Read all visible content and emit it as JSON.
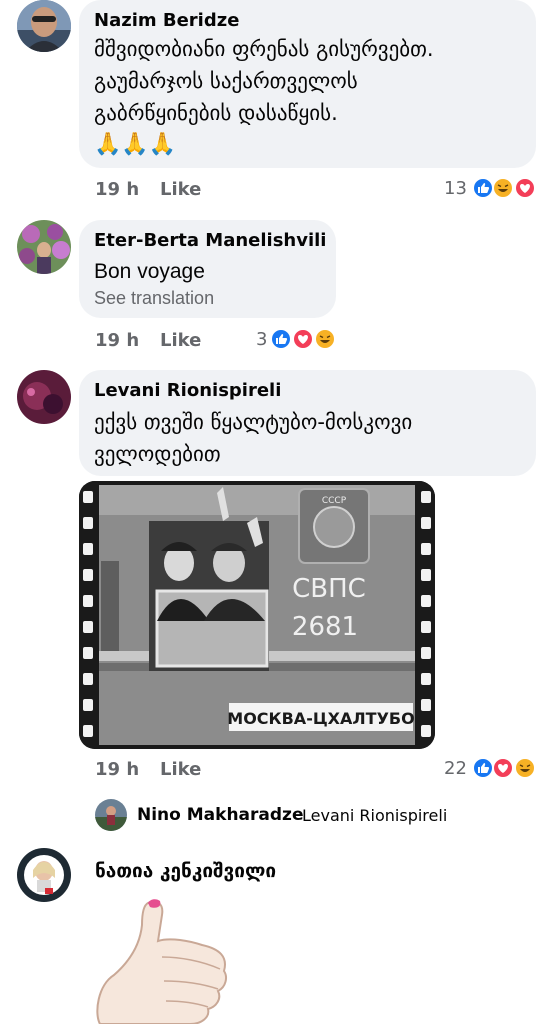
{
  "comments": [
    {
      "author": "Nazim Beridze",
      "lines": [
        "მშვიდობიანი ფრენას გისურვებთ.",
        "გაუმარჯოს საქართველოს",
        "გაბრწყინების დასაწყის."
      ],
      "emoji": "🙏🙏🙏",
      "time": "19 h",
      "like": "Like",
      "reaction_count": "13"
    },
    {
      "author": "Eter-Berta Manelishvili",
      "text": "Bon voyage",
      "see_translation": "See translation",
      "time": "19 h",
      "like": "Like",
      "reaction_count": "3"
    },
    {
      "author": "Levani Rionispireli",
      "lines": [
        "ექვს თვეში წყალტუბო-მოსკოვი",
        "ველოდებით"
      ],
      "photo_texts": {
        "emblem": "СССР",
        "car_line1": "СВПС",
        "car_line2": "2681",
        "route_sign": "МОСКВА-ЦХАЛТУБО"
      },
      "time": "19 h",
      "like": "Like",
      "reaction_count": "22"
    }
  ],
  "reply": {
    "author": "Nino Makharadze",
    "mention": "Levani Rionispireli"
  },
  "last_comment": {
    "author": "ნათია კენკიშვილი"
  },
  "colors": {
    "like_blue": "#1877f2",
    "love_red": "#f33e58",
    "haha_yellow": "#f7b125",
    "meta_gray": "#65676b",
    "bubble_bg": "#f0f2f5"
  }
}
